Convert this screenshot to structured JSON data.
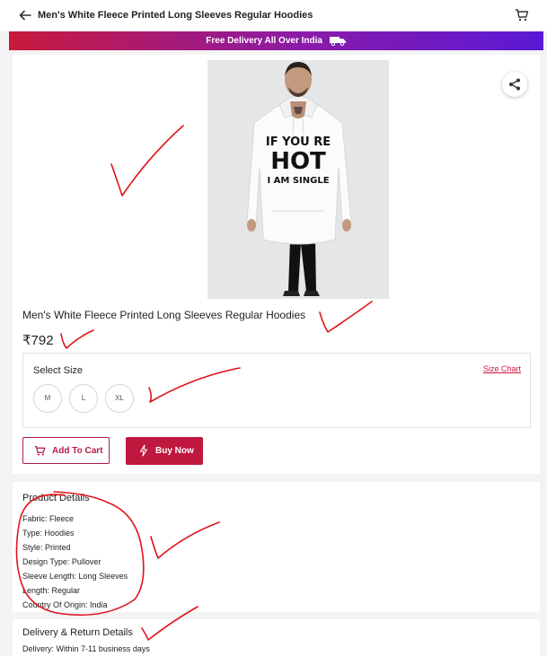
{
  "header": {
    "title": "Men's White Fleece Printed Long Sleeves Regular Hoodies"
  },
  "promo": {
    "text": "Free Delivery All Over India"
  },
  "product": {
    "image_text": [
      "IF YOU RE",
      "HOT",
      "I AM SINGLE"
    ],
    "name": "Men's White Fleece Printed Long Sleeves Regular Hoodies",
    "price": "₹792"
  },
  "size": {
    "label": "Select Size",
    "chart_link": "Size Chart",
    "options": [
      "M",
      "L",
      "XL"
    ]
  },
  "actions": {
    "add_to_cart": "Add To Cart",
    "buy_now": "Buy Now"
  },
  "details": {
    "heading": "Product Details",
    "rows": [
      "Fabric:  Fleece",
      "Type:  Hoodies",
      "Style:  Printed",
      "Design Type:  Pullover",
      "Sleeve Length:  Long Sleeves",
      "Length:  Regular",
      "Country Of Origin:  India"
    ]
  },
  "delivery": {
    "heading": "Delivery & Return Details",
    "line": "Delivery:  Within 7-11 business days"
  },
  "colors": {
    "accent": "#c0173f",
    "annotation": "#e0141a"
  }
}
